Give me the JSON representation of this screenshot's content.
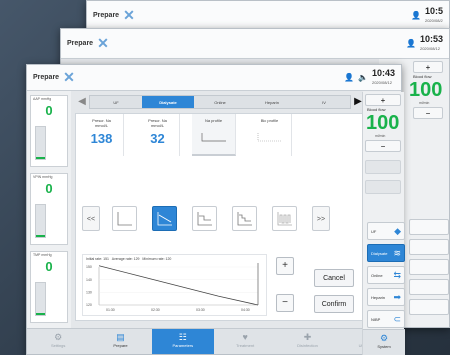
{
  "windows": {
    "back": {
      "title": "Prepare",
      "time": "10:5",
      "date": "2020/08/2"
    },
    "middle": {
      "title": "Prepare",
      "time": "10:53",
      "date": "2020/08/12",
      "blood_flow_label": "Blood flow",
      "blood_flow_value": "100",
      "unit": "ml/min"
    },
    "front": {
      "title": "Prepare",
      "time": "10:43",
      "date": "2020/08/12",
      "blood_flow_label": "Blood flow",
      "blood_flow_value": "100",
      "unit": "ml/min"
    }
  },
  "gauges": [
    {
      "label": "AAP",
      "unit": "mmHg",
      "value": "0",
      "level": 0.05
    },
    {
      "label": "VPIN",
      "unit": "mmHg",
      "value": "0",
      "level": 0.05
    },
    {
      "label": "TMP",
      "unit": "mmHg",
      "value": "0",
      "level": 0.05
    }
  ],
  "tabs": [
    "UF",
    "Dialysate",
    "Online",
    "Heparin",
    "IV"
  ],
  "active_tab": "Dialysate",
  "cards": [
    {
      "label": "Prescr. Na",
      "unit": "mmol/L",
      "value": "138"
    },
    {
      "label": "Prescr. Na",
      "unit": "mmol/L",
      "value": "32"
    },
    {
      "label": "Na profile",
      "unit": "",
      "value": ""
    },
    {
      "label": "Bic profile",
      "unit": "",
      "value": ""
    }
  ],
  "profile_nav": {
    "prev": "<<",
    "next": ">>"
  },
  "chart_data": {
    "type": "line",
    "stats": {
      "initial_rate": "Initial rate: 151",
      "average_rate": "Average rate: 129",
      "minimum_rate": "Minimum rate: 120"
    },
    "x": [
      "01:30",
      "02:30",
      "03:30",
      "04:30"
    ],
    "y_ticks": [
      "150",
      "140",
      "130",
      "120"
    ],
    "series": [
      {
        "values": [
          151,
          143,
          135,
          127,
          120
        ]
      }
    ],
    "ylim": [
      120,
      150
    ]
  },
  "buttons": {
    "plus": "+",
    "minus": "−",
    "cancel": "Cancel",
    "confirm": "Confirm"
  },
  "right_menu": [
    {
      "label": "UF",
      "icon": "uf-icon"
    },
    {
      "label": "Dialysate",
      "icon": "dialysate-icon",
      "active": true
    },
    {
      "label": "Online",
      "icon": "online-icon"
    },
    {
      "label": "Heparin",
      "icon": "heparin-icon"
    },
    {
      "label": "NIBP",
      "icon": "nibp-icon"
    }
  ],
  "system_label": "System",
  "bottom_nav": [
    {
      "label": "Settings",
      "active": false
    },
    {
      "label": "Prepare",
      "active": true
    },
    {
      "label": "Parameters",
      "selected": true
    },
    {
      "label": "Treatment",
      "active": false
    },
    {
      "label": "Disinfection",
      "active": false
    },
    {
      "label": "Ultrafiltration",
      "active": false
    }
  ],
  "colors": {
    "accent": "#2e86d6",
    "value_green": "#19b24b"
  }
}
